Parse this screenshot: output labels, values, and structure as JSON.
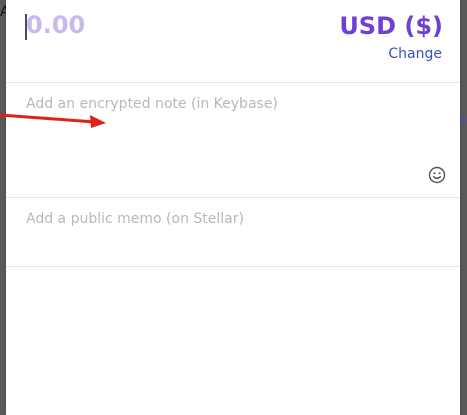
{
  "background": {
    "partial_letter": "A",
    "partial_link": "a"
  },
  "amount": {
    "value_placeholder": "0.00",
    "currency_label": "USD ($)",
    "change_label": "Change"
  },
  "note": {
    "placeholder": "Add an encrypted note (in Keybase)",
    "emoji_icon": "smiley-icon"
  },
  "memo": {
    "placeholder": "Add a public memo (on Stellar)"
  },
  "colors": {
    "accent_purple": "#6f3fd6",
    "placeholder_purple": "#c8b9ec",
    "link_blue": "#3a52c0",
    "annotation_arrow": "#e0201a"
  }
}
